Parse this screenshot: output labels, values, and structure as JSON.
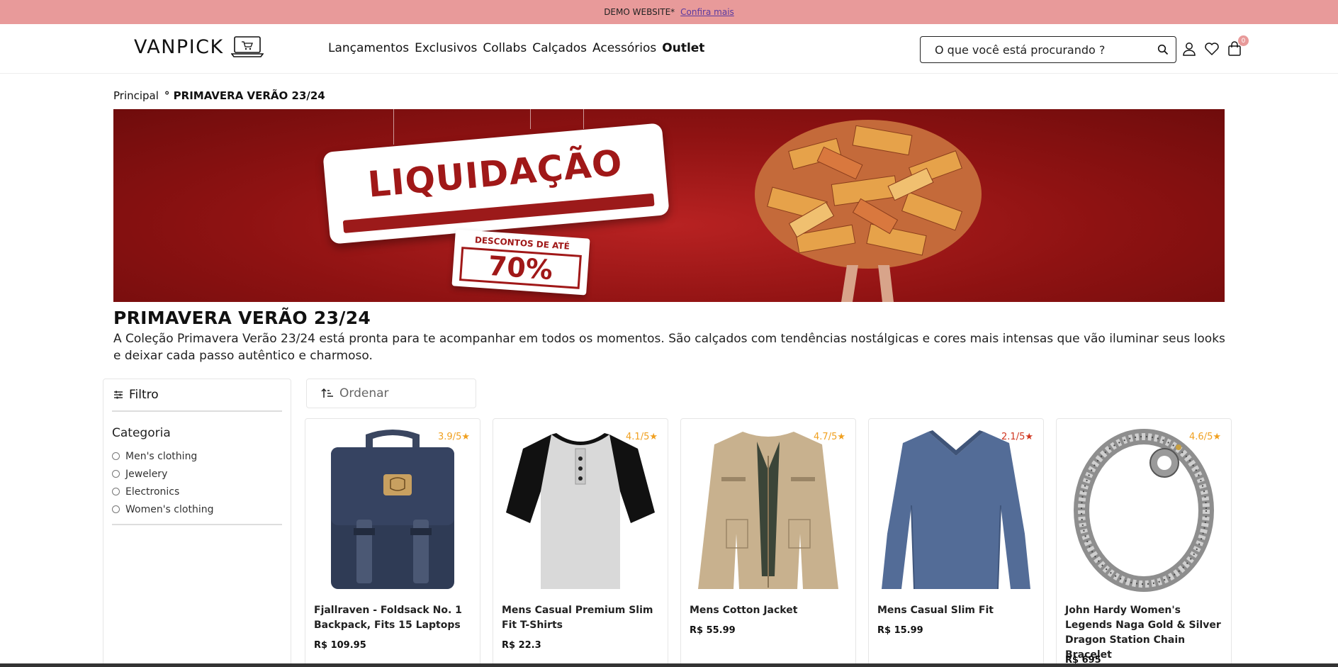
{
  "topbar": {
    "text": "DEMO WEBSITE*",
    "link": "Confira mais"
  },
  "header": {
    "logo": "VANPICK",
    "nav": [
      "Lançamentos",
      "Exclusivos",
      "Collabs",
      "Calçados",
      "Acessórios",
      "Outlet"
    ],
    "search_placeholder": "O que você está procurando ?",
    "cart_count": "0"
  },
  "breadcrumb": {
    "home": "Principal",
    "current": "° PRIMAVERA VERÃO 23/24"
  },
  "banner": {
    "headline": "LIQUIDAÇÃO",
    "subline": "DESCONTOS DE ATÉ",
    "discount": "70%"
  },
  "collection": {
    "title": "PRIMAVERA VERÃO 23/24",
    "description": "A Coleção Primavera Verão 23/24 está pronta para te acompanhar em todos os momentos. São calçados com tendências nostálgicas e cores mais intensas que vão iluminar seus looks e deixar cada passo autêntico e charmoso."
  },
  "filter": {
    "label": "Filtro",
    "category_title": "Categoria",
    "categories": [
      "Men's clothing",
      "Jewelery",
      "Electronics",
      "Women's clothing"
    ]
  },
  "sort": {
    "label": "Ordenar"
  },
  "products": [
    {
      "rating": "3.9/5",
      "rating_color": "#f0a020",
      "title": "Fjallraven - Foldsack No. 1 Backpack, Fits 15 Laptops",
      "price": "R$ 109.95"
    },
    {
      "rating": "4.1/5",
      "rating_color": "#f0a020",
      "title": "Mens Casual Premium Slim Fit T-Shirts",
      "price": "R$ 22.3"
    },
    {
      "rating": "4.7/5",
      "rating_color": "#f0a020",
      "title": "Mens Cotton Jacket",
      "price": "R$ 55.99"
    },
    {
      "rating": "2.1/5",
      "rating_color": "#d0351f",
      "title": "Mens Casual Slim Fit",
      "price": "R$ 15.99"
    },
    {
      "rating": "4.6/5",
      "rating_color": "#f0a020",
      "title": "John Hardy Women's Legends Naga Gold & Silver Dragon Station Chain Bracelet",
      "price": "R$ 695"
    }
  ]
}
